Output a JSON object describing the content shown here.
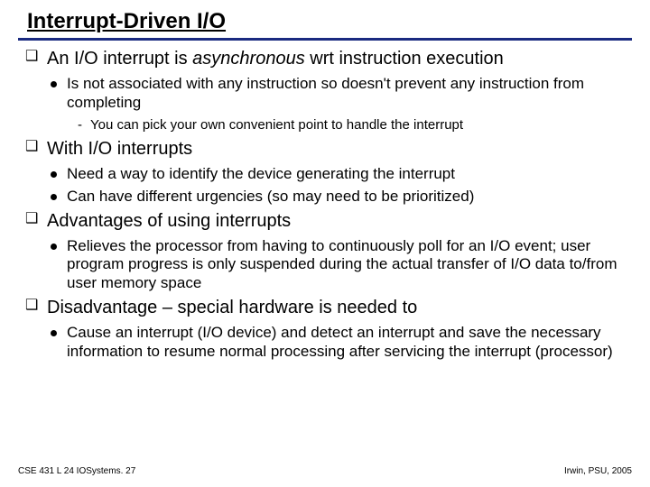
{
  "title": "Interrupt-Driven I/O",
  "bullets": [
    {
      "pre": "An I/O interrupt is ",
      "em": "asynchronous",
      "post": " wrt instruction execution",
      "sub": [
        {
          "text": "Is not associated with any instruction so doesn't prevent any instruction from completing",
          "sub": [
            {
              "text": "You can pick your own convenient point to handle the interrupt"
            }
          ]
        }
      ]
    },
    {
      "pre": "With I/O interrupts",
      "sub": [
        {
          "text": "Need a way to identify the device generating the interrupt"
        },
        {
          "text": "Can have different urgencies (so may need to be prioritized)"
        }
      ]
    },
    {
      "pre": "Advantages of using interrupts",
      "sub": [
        {
          "text": "Relieves the processor from having to continuously poll for an I/O event; user program progress is only suspended during the actual transfer of I/O data to/from user memory space"
        }
      ]
    },
    {
      "pre": "Disadvantage – special hardware is needed to",
      "sub": [
        {
          "text": "Cause an interrupt (I/O device) and detect an interrupt and save the necessary information to resume normal processing after servicing the interrupt (processor)"
        }
      ]
    }
  ],
  "footer": {
    "left": "CSE 431  L 24 IOSystems. 27",
    "right": "Irwin, PSU, 2005"
  }
}
